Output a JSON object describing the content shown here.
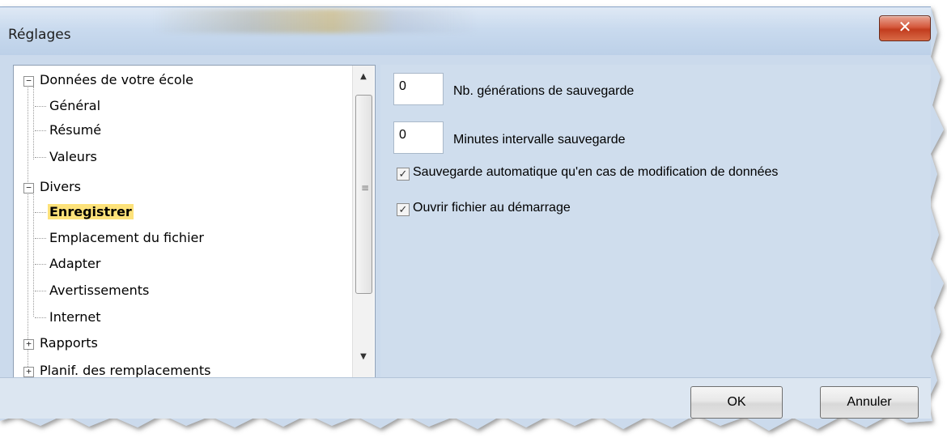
{
  "window": {
    "title": "Réglages",
    "close_glyph": "✕"
  },
  "tree": {
    "items": [
      {
        "label": "Données de votre école",
        "expander": "−"
      },
      {
        "label": "Général"
      },
      {
        "label": "Résumé"
      },
      {
        "label": "Valeurs"
      },
      {
        "label": "Divers",
        "expander": "−"
      },
      {
        "label": "Enregistrer"
      },
      {
        "label": "Emplacement du fichier"
      },
      {
        "label": "Adapter"
      },
      {
        "label": "Avertissements"
      },
      {
        "label": "Internet"
      },
      {
        "label": "Rapports",
        "expander": "+"
      },
      {
        "label": "Planif. des remplacements",
        "expander": "+"
      }
    ],
    "scroll_up": "▲",
    "scroll_down": "▼",
    "grip": "≡"
  },
  "settings": {
    "backup_generations": {
      "value": "0",
      "label": "Nb. générations de sauvegarde"
    },
    "backup_interval": {
      "value": "0",
      "label": "Minutes intervalle sauvegarde"
    },
    "auto_save_on_change": {
      "checked": true,
      "check_glyph": "✓",
      "label": "Sauvegarde automatique qu'en cas de modification de données"
    },
    "open_file_on_start": {
      "checked": true,
      "check_glyph": "✓",
      "label": "Ouvrir fichier au démarrage"
    }
  },
  "footer": {
    "ok_label": "OK",
    "cancel_label": "Annuler"
  },
  "colors": {
    "selected_highlight": "#fde27a",
    "panel_background": "#cfdded",
    "close_button": "#c23c1e"
  }
}
